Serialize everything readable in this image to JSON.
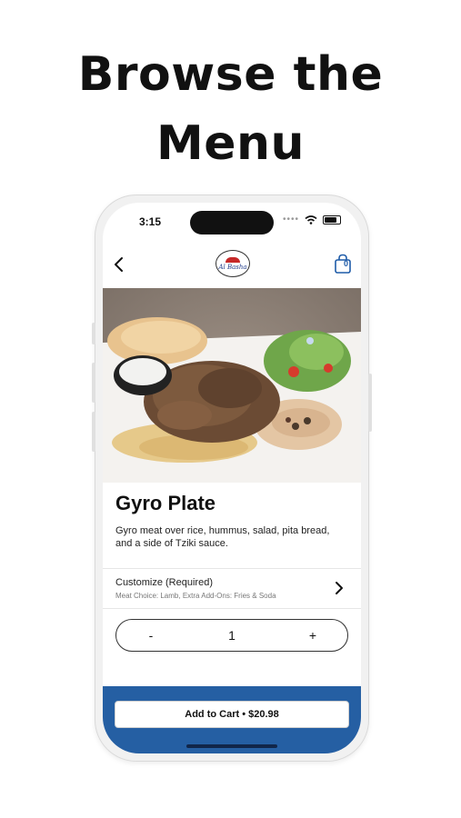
{
  "headline": {
    "line1": "Browse the",
    "line2": "Menu"
  },
  "status_bar": {
    "time": "3:15"
  },
  "nav": {
    "logo_text": "Al Basha",
    "cart_count": "0"
  },
  "item": {
    "name": "Gyro Plate",
    "description": "Gyro meat over rice, hummus, salad, pita bread, and a side of Tziki sauce."
  },
  "customize": {
    "title": "Customize (Required)",
    "summary": "Meat Choice: Lamb, Extra Add-Ons: Fries & Soda"
  },
  "quantity": {
    "minus": "-",
    "value": "1",
    "plus": "+"
  },
  "cart_button": {
    "label": "Add to Cart • $20.98"
  },
  "colors": {
    "brand_blue": "#255fa3",
    "logo_red": "#c62828"
  },
  "icons": [
    "back-chevron-icon",
    "shopping-bag-icon",
    "chevron-right-icon",
    "wifi-icon",
    "battery-icon"
  ]
}
